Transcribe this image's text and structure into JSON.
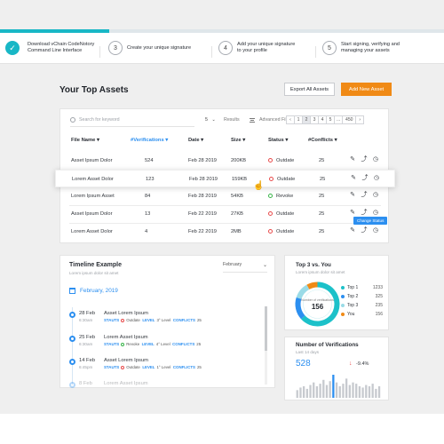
{
  "progress": {
    "fraction": 0.245
  },
  "steps": [
    {
      "number": "✓",
      "line1": "Download vChain CodeNotory",
      "line2": "Command Line Interface",
      "done": true
    },
    {
      "number": "3",
      "line1": "Create your unique signature",
      "line2": "",
      "done": false
    },
    {
      "number": "4",
      "line1": "Add your unique signature",
      "line2": "to your profile",
      "done": false
    },
    {
      "number": "5",
      "line1": "Start signing, verifying and",
      "line2": "managing your assets",
      "done": false
    }
  ],
  "header": {
    "title": "Your Top Assets",
    "export_label": "Export All Assets",
    "add_label": "Add New Asset"
  },
  "toolbar": {
    "search_placeholder": "Search for keyword",
    "per_page": "5",
    "results_label": "Results",
    "filter_label": "Advanced Filter",
    "pages": [
      "‹",
      "1",
      "2",
      "3",
      "4",
      "5",
      "...",
      "450",
      "›"
    ],
    "active_page": "2"
  },
  "table": {
    "columns": [
      "File Name ▾",
      "#Verifications ▾",
      "Date ▾",
      "Size ▾",
      "Status ▾",
      "#Conflicts ▾"
    ],
    "rows": [
      {
        "name": "Asset Ipsum Dolor",
        "verifications": "524",
        "date": "Feb 28 2019",
        "size": "200KB",
        "status": "Outdate",
        "status_color": "#e84c4c",
        "conflicts": "25"
      },
      {
        "name": "Lorem Asset Dolor",
        "verifications": "123",
        "date": "Feb 28 2019",
        "size": "159KB",
        "status": "Outdate",
        "status_color": "#e84c4c",
        "conflicts": "25"
      },
      {
        "name": "Lorem Ipsum Asset",
        "verifications": "84",
        "date": "Feb 28 2019",
        "size": "54KB",
        "status": "Revoke",
        "status_color": "#39b54a",
        "conflicts": "25"
      },
      {
        "name": "Asset Ipsum Dolor",
        "verifications": "13",
        "date": "Feb 22 2019",
        "size": "27KB",
        "status": "Outdate",
        "status_color": "#e84c4c",
        "conflicts": "25"
      },
      {
        "name": "Lorem Asset Dolor",
        "verifications": "4",
        "date": "Feb 22 2019",
        "size": "2MB",
        "status": "Outdate",
        "status_color": "#e84c4c",
        "conflicts": "25"
      }
    ],
    "tooltip": "Change Status"
  },
  "timeline": {
    "title": "Timeline Example",
    "subtitle": "Lorem ipsum dolor sit amet",
    "select_value": "February",
    "month": "February, 2019",
    "items": [
      {
        "date": "28 Feb",
        "time": "6:30am",
        "name": "Asset Lorem Ipsum",
        "status_label": "STAUTS",
        "status": "Outdate",
        "level_label": "LEVEL",
        "level": "3° Level",
        "conflicts_label": "CONFLICTS",
        "conflicts": "25"
      },
      {
        "date": "25 Feb",
        "time": "6:30am",
        "name": "Lorem Asset Ipsum",
        "status_label": "STAUTS",
        "status": "Revoke",
        "level_label": "LEVEL",
        "level": "4° Level",
        "conflicts_label": "CONFLICTS",
        "conflicts": "25"
      },
      {
        "date": "14 Feb",
        "time": "6:45pm",
        "name": "Asset Lorem Ipsum",
        "status_label": "STAUTS",
        "status": "Outdate",
        "level_label": "LEVEL",
        "level": "1° Level",
        "conflicts_label": "CONFLICTS",
        "conflicts": "25"
      },
      {
        "date": "8 Feb",
        "time": "",
        "name": "Lorem Asset Ipsum",
        "status_label": "",
        "status": "",
        "level_label": "",
        "level": "",
        "conflicts_label": "",
        "conflicts": ""
      }
    ]
  },
  "top3": {
    "title": "Top 3 vs. You",
    "subtitle": "Lorem ipsum dolor sit amet",
    "center_label": "Number of verifications",
    "center_value": "156",
    "legend": [
      {
        "name": "Top 1",
        "value": "1233",
        "color": "#1cc1c9"
      },
      {
        "name": "Top 2",
        "value": "325",
        "color": "#2c8ff0"
      },
      {
        "name": "Top 3",
        "value": "235",
        "color": "#9adbe7"
      },
      {
        "name": "You",
        "value": "156",
        "color": "#f08a16"
      }
    ]
  },
  "verifications": {
    "title": "Number of Verifications",
    "subtitle": "Last 14 days",
    "value": "528",
    "delta": "-9.4%",
    "bar_color": "#c7cacf",
    "highlight_color": "#2c8ff0",
    "bars": [
      6,
      8,
      9,
      7,
      10,
      12,
      9,
      11,
      14,
      10,
      13,
      18,
      12,
      9,
      11,
      15,
      10,
      12,
      11,
      9,
      8,
      10,
      9,
      11,
      7,
      9
    ]
  }
}
